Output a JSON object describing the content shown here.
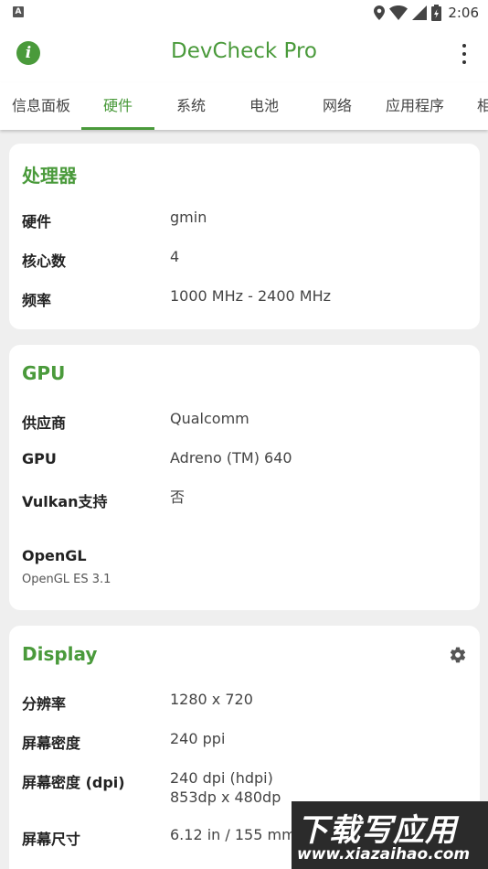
{
  "status_bar": {
    "notification_letter": "A",
    "icons": [
      "location-icon",
      "wifi-icon",
      "signal-icon",
      "battery-icon"
    ],
    "time": "2:06"
  },
  "app_bar": {
    "title": "DevCheck Pro",
    "accent_color": "#4a9a3b"
  },
  "tabs": [
    {
      "label": "信息面板",
      "active": false
    },
    {
      "label": "硬件",
      "active": true
    },
    {
      "label": "系统",
      "active": false
    },
    {
      "label": "电池",
      "active": false
    },
    {
      "label": "网络",
      "active": false
    },
    {
      "label": "应用程序",
      "active": false
    },
    {
      "label": "相",
      "active": false
    }
  ],
  "processor": {
    "title": "处理器",
    "rows": [
      {
        "label": "硬件",
        "value": "gmin"
      },
      {
        "label": "核心数",
        "value": "4"
      },
      {
        "label": "频率",
        "value": "1000 MHz - 2400 MHz"
      }
    ]
  },
  "gpu": {
    "title": "GPU",
    "rows": [
      {
        "label": "供应商",
        "value": "Qualcomm"
      },
      {
        "label": "GPU",
        "value": "Adreno (TM) 640"
      },
      {
        "label": "Vulkan支持",
        "value": "否"
      }
    ],
    "opengl_label": "OpenGL",
    "opengl_value": "OpenGL ES 3.1"
  },
  "display": {
    "title": "Display",
    "rows": [
      {
        "label": "分辨率",
        "value": "1280 x 720"
      },
      {
        "label": "屏幕密度",
        "value": "240 ppi"
      },
      {
        "label": "屏幕密度 (dpi)",
        "value": "240 dpi (hdpi)",
        "value2": "853dp x 480dp"
      },
      {
        "label": "屏幕尺寸",
        "value": "6.12 in / 155 mm"
      }
    ]
  },
  "watermark": {
    "line1": "下载写应用",
    "line2": "www.xiazaihao.com"
  }
}
